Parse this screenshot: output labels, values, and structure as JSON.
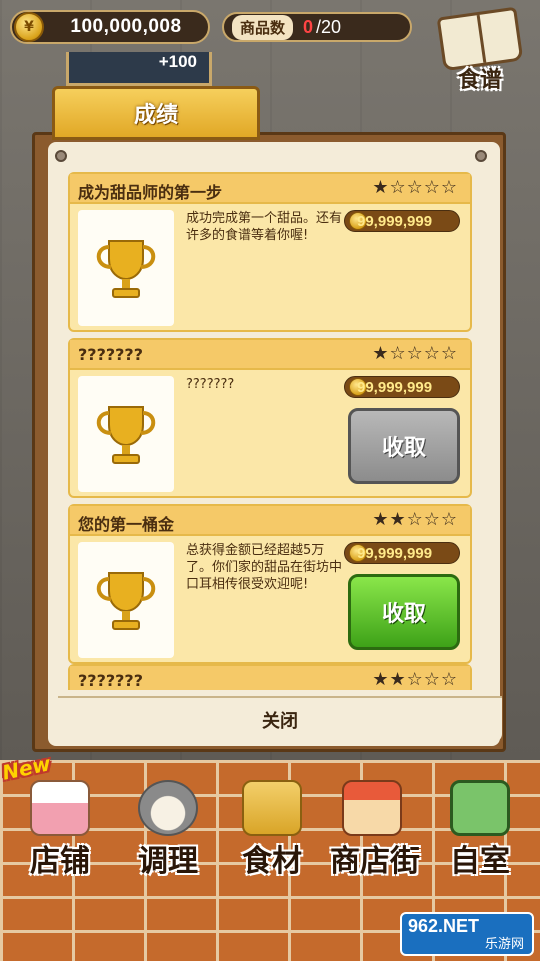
{
  "hud": {
    "coin_symbol": "¥",
    "money": "100,000,008",
    "goods_label": "商品数",
    "goods_count": "0",
    "goods_total": "/20",
    "recipe_label": "食谱",
    "reward_peek": "+100"
  },
  "panel": {
    "tab_title": "成绩",
    "close_label": "关闭"
  },
  "achievements": [
    {
      "title": "成为甜品师的第一步",
      "stars": "★☆☆☆☆",
      "desc": "成功完成第一个甜品。还有许多的食谱等着你喔!",
      "reward": "99,999,999",
      "button": ""
    },
    {
      "title": "???????",
      "stars": "★☆☆☆☆",
      "desc": "???????",
      "reward": "99,999,999",
      "button": "收取",
      "button_state": "disabled"
    },
    {
      "title": "您的第一桶金",
      "stars": "★★☆☆☆",
      "desc": "总获得金额已经超越5万了。你们家的甜品在街坊中口耳相传很受欢迎呢!",
      "reward": "99,999,999",
      "button": "收取",
      "button_state": "active"
    },
    {
      "title": "???????",
      "stars": "★★☆☆☆"
    }
  ],
  "nav": {
    "new_badge": "New",
    "items": [
      {
        "label": "店铺",
        "icon": "cake-icon"
      },
      {
        "label": "调理",
        "icon": "mixing-bowl-icon"
      },
      {
        "label": "食材",
        "icon": "flour-bag-icon"
      },
      {
        "label": "商店街",
        "icon": "shop-street-icon"
      },
      {
        "label": "自室",
        "icon": "staff-only-sign-icon"
      }
    ]
  },
  "watermark": {
    "line1": "962.NET",
    "line2": "乐游网"
  },
  "colors": {
    "accent": "#f5c968",
    "collect_active": "#3ea218",
    "collect_disabled": "#8c8c8c"
  }
}
